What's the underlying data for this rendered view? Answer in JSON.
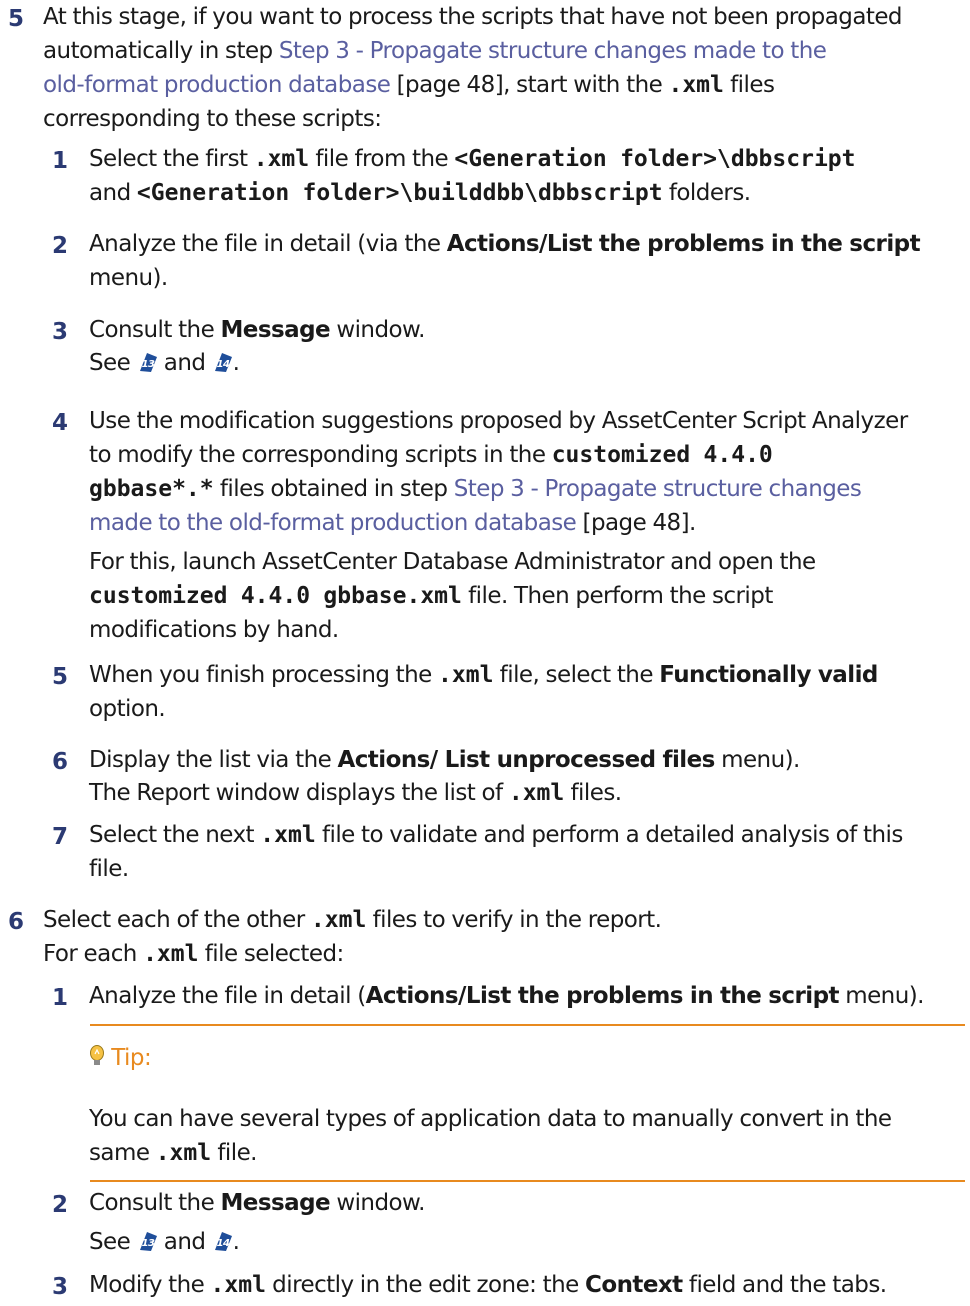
{
  "step5": {
    "num": "5",
    "l1": "At this stage, if you want to process the scripts that have not been propagated",
    "l2_pre": "automatically in step ",
    "link_a": "Step 3 - Propagate structure changes made to the",
    "link_b": "old-format production database",
    "page_ref": " [page 48], start with the ",
    "xml": ".xml",
    "l3_post": " files",
    "l4": "corresponding to these scripts:",
    "sub": {
      "i1": {
        "num": "1",
        "a": "Select the first ",
        "xml": ".xml",
        "b": " file from the ",
        "gen1": "<Generation folder>\\dbbscript",
        "and": "and ",
        "gen2": "<Generation folder>\\builddbb\\dbbscript",
        "folders": " folders."
      },
      "i2": {
        "num": "2",
        "a": "Analyze the file in detail (via the ",
        "menu": "Actions/List the problems in the script",
        "b": "menu)."
      },
      "i3": {
        "num": "3",
        "a": "Consult the ",
        "msg": "Message",
        "b": " window.",
        "see": "See ",
        "and": " and ",
        "end": ".",
        "ref13": "13",
        "ref14": "14"
      },
      "i4": {
        "num": "4",
        "l1": "Use the modification suggestions proposed by AssetCenter Script Analyzer",
        "l2_pre": "to modify the corresponding scripts in the ",
        "custom": "customized 4.4.0",
        "gb": "gbbase*.*",
        "l3_post": " files obtained in step ",
        "link_a": "Step 3 - Propagate structure changes",
        "link_b": "made to the old-format production database",
        "page_ref": " [page 48].",
        "p2_l1": "For this, launch AssetCenter Database Administrator and open the",
        "p2_code": "customized 4.4.0 gbbase.xml",
        "p2_mid": " file. Then perform the script",
        "p2_l3": "modifications by hand."
      },
      "i5": {
        "num": "5",
        "a": "When you finish processing the ",
        "xml": ".xml",
        "b": " file, select the ",
        "fv": "Functionally valid",
        "c": "option."
      },
      "i6": {
        "num": "6",
        "a": "Display the list via the ",
        "menu": "Actions/ List unprocessed files",
        "b": " menu).",
        "p2_a": "The Report window displays the list of ",
        "xml": ".xml",
        "p2_b": " files."
      },
      "i7": {
        "num": "7",
        "a": "Select the next ",
        "xml": ".xml",
        "b": " file to validate and perform a detailed analysis of this",
        "c": "file."
      }
    }
  },
  "step6": {
    "num": "6",
    "a": "Select each of the other ",
    "xml": ".xml",
    "b": " files to verify in the report.",
    "p2_a": "For each ",
    "p2_b": " file selected:",
    "sub": {
      "i1": {
        "num": "1",
        "a": "Analyze the file in detail (",
        "menu": "Actions/List the problems in the script",
        "b": " menu)."
      },
      "tip": {
        "label": "Tip:",
        "l1": "You can have several types of application data to manually convert in the",
        "l2_a": "same ",
        "l2_b": " file."
      },
      "i2": {
        "num": "2",
        "a": "Consult the ",
        "msg": "Message",
        "b": " window.",
        "see": "See ",
        "and": " and ",
        "end": ".",
        "ref13": "13",
        "ref14": "14"
      },
      "i3": {
        "num": "3",
        "a": "Modify the ",
        "xml": ".xml",
        "b": " directly in the edit zone: the ",
        "ctx": "Context",
        "c": " field and the tabs."
      }
    }
  },
  "colors": {
    "step_number": "#2b3a73",
    "link": "#5a5fa0",
    "tip_accent": "#e88a1f"
  },
  "icons": {
    "callout_badge": "callout-number-badge-icon",
    "tip": "lightbulb-icon"
  }
}
